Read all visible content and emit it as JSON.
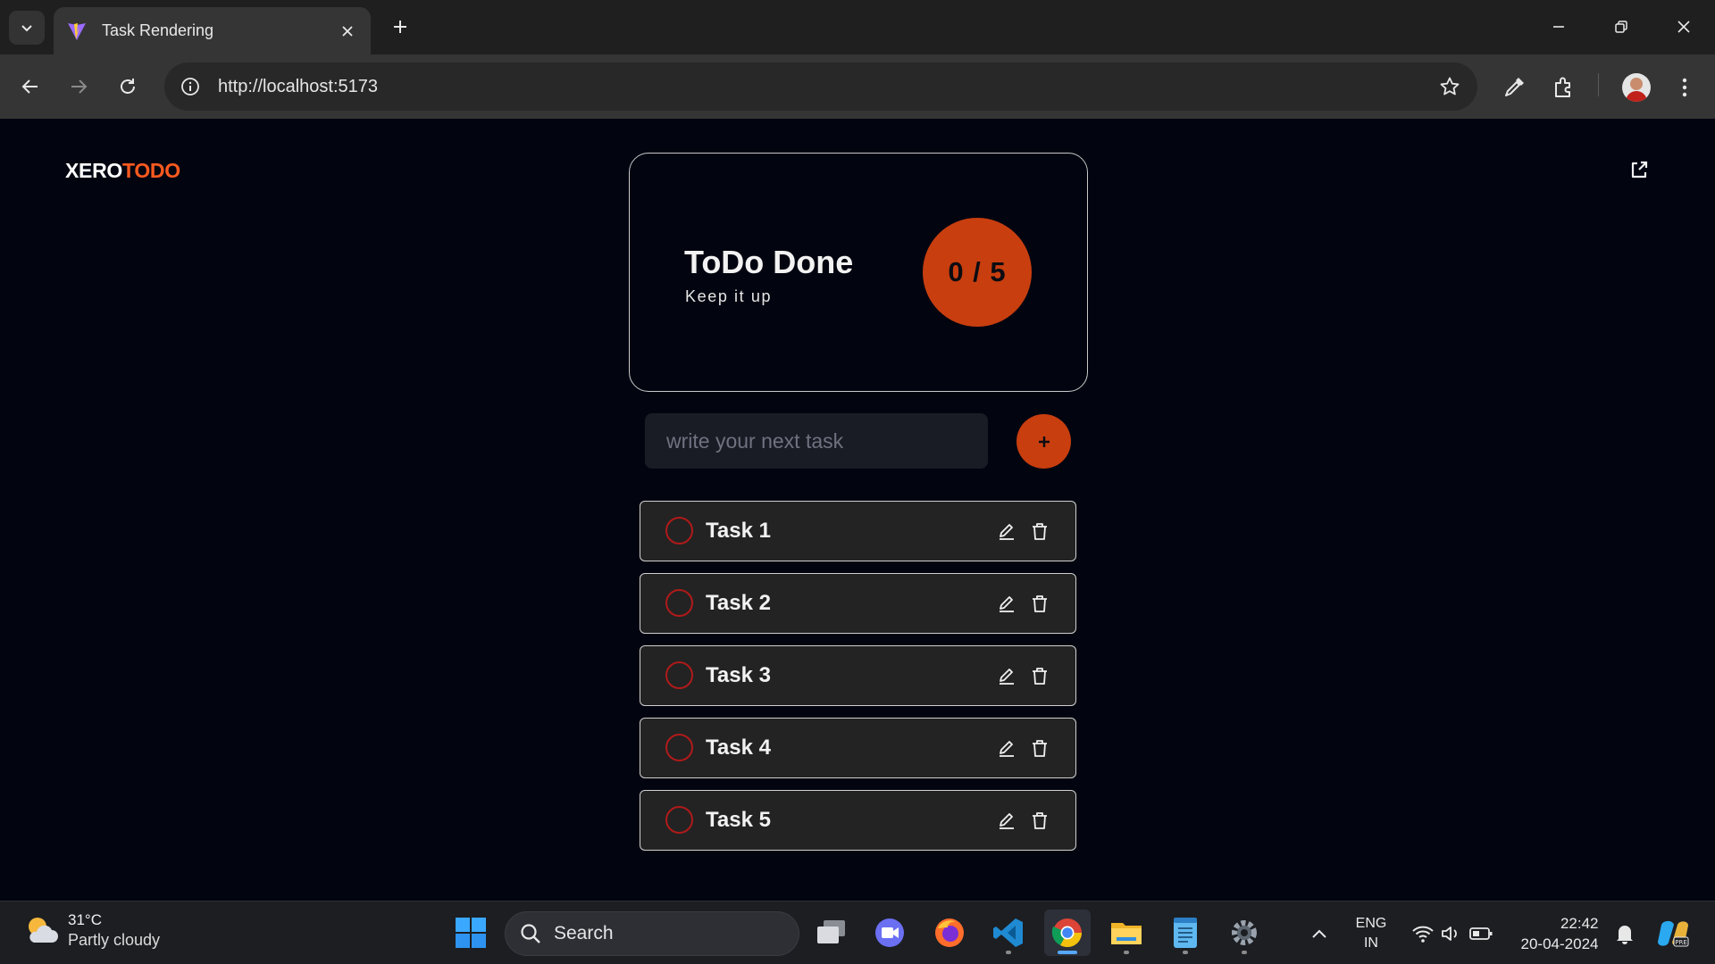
{
  "browser": {
    "tab_title": "Task Rendering",
    "url": "http://localhost:5173"
  },
  "app": {
    "logo_part_a": "XERO",
    "logo_part_b": "TODO",
    "summary_title": "ToDo Done",
    "summary_subtitle": "Keep it up",
    "counter": "0 / 5",
    "counter_done": 0,
    "counter_total": 5,
    "input_placeholder": "write your next task",
    "add_label": "+",
    "accent_color": "#c83e0f",
    "tasks": [
      {
        "label": "Task 1",
        "done": false
      },
      {
        "label": "Task 2",
        "done": false
      },
      {
        "label": "Task 3",
        "done": false
      },
      {
        "label": "Task 4",
        "done": false
      },
      {
        "label": "Task 5",
        "done": false
      }
    ]
  },
  "taskbar": {
    "weather_temp": "31°C",
    "weather_condition": "Partly cloudy",
    "search_label": "Search",
    "lang_top": "ENG",
    "lang_bottom": "IN",
    "time": "22:42",
    "date": "20-04-2024"
  },
  "icons": [
    "tab-list-icon",
    "vite-icon",
    "close-icon",
    "plus-icon",
    "minimize-icon",
    "restore-icon",
    "back-icon",
    "forward-icon",
    "reload-icon",
    "info-icon",
    "star-icon",
    "eyedropper-icon",
    "extensions-icon",
    "kebab-icon",
    "share-icon",
    "edit-icon",
    "trash-icon",
    "weather-icon",
    "windows-icon",
    "search-icon",
    "task-view-icon",
    "meet-icon",
    "firefox-icon",
    "vscode-icon",
    "chrome-icon",
    "file-explorer-icon",
    "notepad-icon",
    "settings-icon",
    "chevron-up-icon",
    "wifi-icon",
    "volume-icon",
    "battery-icon",
    "bell-icon",
    "copilot-icon"
  ]
}
